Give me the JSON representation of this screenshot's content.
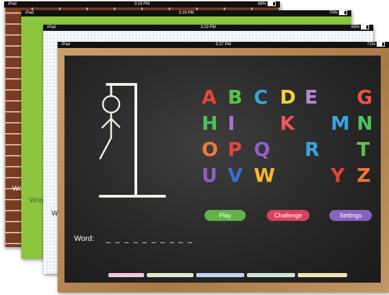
{
  "screens": [
    {
      "device": "iPad",
      "time": "3:19 PM",
      "battery": "69%",
      "battery_level": 0.69,
      "word_label": "Wo"
    },
    {
      "device": "iPad",
      "time": "3:19 PM",
      "battery": "70%",
      "battery_level": 0.7,
      "word_label": "Word"
    },
    {
      "device": "iPad",
      "time": "3:19 PM",
      "battery": "69%",
      "battery_level": 0.69,
      "word_label": "W"
    },
    {
      "device": "iPad",
      "time": "5:27 PM",
      "battery": "71%",
      "battery_level": 0.71
    }
  ],
  "game": {
    "letters": [
      {
        "char": "A",
        "color": "#e8433a"
      },
      {
        "char": "B",
        "color": "#5cc24a"
      },
      {
        "char": "C",
        "color": "#3aa4e0"
      },
      {
        "char": "D",
        "color": "#f2d23a"
      },
      {
        "char": "E",
        "color": "#b388d6"
      },
      {
        "char": "G",
        "color": "#ef5148"
      },
      {
        "char": "H",
        "color": "#4cc25a"
      },
      {
        "char": "I",
        "color": "#b071d2"
      },
      {
        "char": "K",
        "color": "#f0555a"
      },
      {
        "char": "M",
        "color": "#3aa4e0"
      },
      {
        "char": "N",
        "color": "#4cc25a"
      },
      {
        "char": "O",
        "color": "#f07a3a"
      },
      {
        "char": "P",
        "color": "#e8433a"
      },
      {
        "char": "Q",
        "color": "#8f5fc8"
      },
      {
        "char": "R",
        "color": "#3aa4e0"
      },
      {
        "char": "T",
        "color": "#5cc24a"
      },
      {
        "char": "U",
        "color": "#8f5fc8"
      },
      {
        "char": "V",
        "color": "#3a6fd0"
      },
      {
        "char": "W",
        "color": "#f5b82e"
      },
      {
        "char": "Y",
        "color": "#e8433a"
      },
      {
        "char": "Z",
        "color": "#f07a3a"
      }
    ],
    "buttons": {
      "play": "Play",
      "challenge": "Challenge",
      "settings": "Settings"
    },
    "button_colors": {
      "play": "#62b34a",
      "challenge": "#d9435a",
      "settings": "#8a62c0"
    },
    "word_label": "Word:",
    "blanks": "_ _ _ _ _ _ _ _ _ _"
  }
}
